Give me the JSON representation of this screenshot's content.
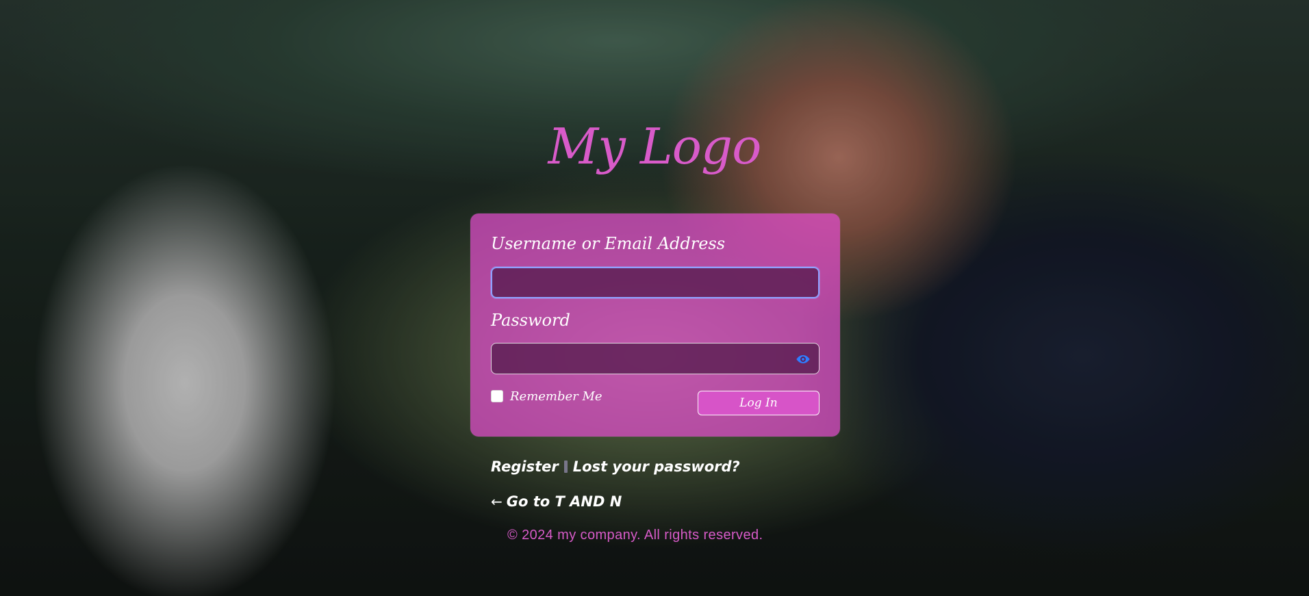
{
  "brand": {
    "logo_text": "My Logo",
    "primary_color": "#d85bc9",
    "card_color": "#e24dcd"
  },
  "form": {
    "username_label": "Username or Email Address",
    "username_value": "",
    "password_label": "Password",
    "password_value": "",
    "password_toggle_icon": "eye-icon",
    "remember_label": "Remember Me",
    "remember_checked": false,
    "login_button": "Log In"
  },
  "links": {
    "register": "Register",
    "lost_password": "Lost your password?",
    "back_arrow": "←",
    "back_text": "Go to T AND N"
  },
  "footer": {
    "copyright": "© 2024 my company. All rights reserved."
  }
}
